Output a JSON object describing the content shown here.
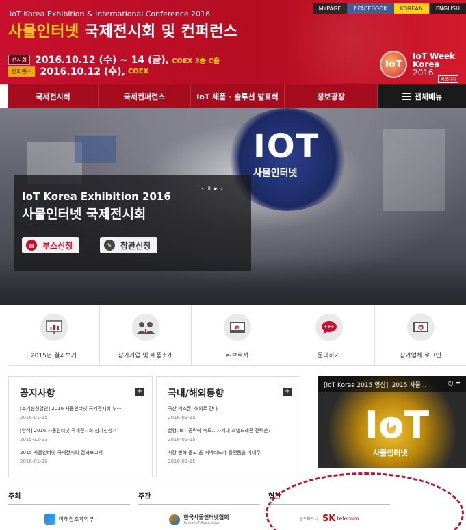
{
  "header": {
    "subtitle": "IoT Korea Exhibition & International Conference 2016",
    "title_highlight": "사물인터넷",
    "title_rest": " 국제전시회 및 컨퍼런스",
    "exhibition_badge": "전시회",
    "exhibition_date": "2016.10.12 (수) ~ 14 (금),",
    "exhibition_venue": "COEX 3층 C홀",
    "conference_badge": "컨퍼런스",
    "conference_date": "2016.10.12 (수),",
    "conference_venue": "COEX",
    "iot_week_badge": "IoT",
    "iot_week_line1": "IoT Week",
    "iot_week_line2": "Korea",
    "iot_week_year": "2016",
    "iot_week_more": "바로가기"
  },
  "top_links": [
    "MYPAGE",
    "f FACEBOOK",
    "KOREAN",
    "ENGLISH"
  ],
  "nav": {
    "items": [
      "국제전시회",
      "국제컨퍼런스",
      "IoT 제품 · 솔루션 발표회",
      "정보광장"
    ],
    "all_menu": "전체메뉴"
  },
  "hero": {
    "slider_controls": "‹ ॥ ▸ ›",
    "title_en": "IoT Korea Exhibition 2016",
    "title_kr": "사물인터넷 국제전시회",
    "booth_button": "부스신청",
    "visit_button": "참관신청",
    "sign_text": "IOT",
    "sign_sub": "사물인터넷"
  },
  "quick_links": [
    {
      "label": "2015년 결과보기",
      "icon": "chart-icon"
    },
    {
      "label": "참가기업 및 제품소개",
      "icon": "people-icon"
    },
    {
      "label": "e-브로셔",
      "icon": "ebrochure-icon"
    },
    {
      "label": "문의하기",
      "icon": "chat-icon"
    },
    {
      "label": "참가업체 로그인",
      "icon": "login-icon"
    }
  ],
  "notices": {
    "title": "공지사항",
    "more": "+",
    "items": [
      {
        "title": "[조기신청할인] 2016 사물인터넷 국제전시회 부···",
        "date": "2016-01-15"
      },
      {
        "title": "[양식] 2016 사물인터넷 국제전시회 참가신청서",
        "date": "2015-12-23"
      },
      {
        "title": "2015 사물인터넷 국제전시회 결과보고서",
        "date": "2016-01-29"
      }
    ]
  },
  "news": {
    "title": "국내/해외동향",
    "more": "+",
    "items": [
      {
        "title": "국산 키즈폰, 해외로 간다",
        "date": "2016-02-15"
      },
      {
        "title": "철컹, IoT 공략에 속도…차세대 스냅드래곤 전략은?",
        "date": "2016-02-15"
      },
      {
        "title": "시장 변화 몰고 올 커넥티드카 플랫폼을 기대주",
        "date": "2016-02-15"
      }
    ]
  },
  "video": {
    "title": "[IoT Korea 2015 영상] '2015 사물...",
    "big_text": "IoT",
    "sub_text": "사물인터넷"
  },
  "sponsors": {
    "host_label": "주최",
    "host_name": "미래창조과학부",
    "organizer_label": "주관",
    "organizer_name": "한국사물인터넷협회",
    "organizer_sub": "Korea IoT Association",
    "sponsor_label": "협찬",
    "sponsor_prefix": "골드파트너",
    "sponsor_mark": "SK",
    "sponsor_name": "telecom"
  },
  "colors": {
    "brand_red": "#c8102e",
    "nav_red": "#a50d1f",
    "highlight_yellow": "#ffd400",
    "menu_dark": "#1a1a1a"
  }
}
